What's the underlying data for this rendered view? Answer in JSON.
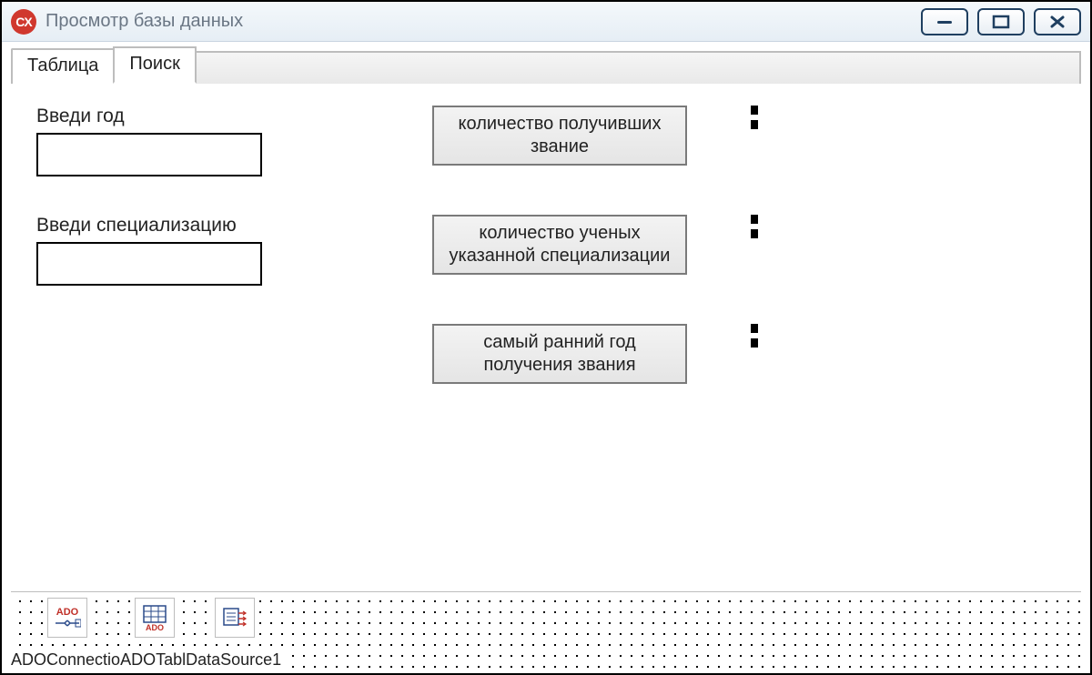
{
  "window": {
    "title": "Просмотр базы данных",
    "icon_text": "CX"
  },
  "tabs": {
    "tab1": "Таблица",
    "tab2": "Поиск"
  },
  "form": {
    "year_label": "Введи год",
    "year_value": "",
    "spec_label": "Введи специализацию",
    "spec_value": "",
    "btn1": "количество получивших звание",
    "btn2": "количество ученых указанной  специализации",
    "btn3": "самый ранний год получения звания",
    "result1": "",
    "result2": "",
    "result3": ""
  },
  "components": {
    "c1_icon": "ADO",
    "c1_label": "ADOConnectio",
    "c2_icon": "ADO",
    "c2_label": "ADOTabl",
    "c3_icon": "",
    "c3_label": "DataSource1"
  }
}
